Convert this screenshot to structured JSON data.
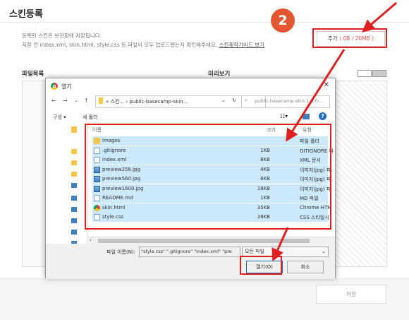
{
  "page": {
    "title": "스킨등록",
    "notice_line1": "등록된 스킨은 보관함에 저장됩니다.",
    "notice_line2": "저장 전 index.xml, skin.html, style.css 등 파일이 모두 업로드됐는지 확인해주세요.",
    "guide_link": "스킨제작가이드 보기",
    "add_button": {
      "label": "추가",
      "quota": "( 0B / 20MB )"
    },
    "file_list_label": "파일목록",
    "preview_label": "미리보기",
    "save_button": "저장",
    "step_number": "2"
  },
  "dialog": {
    "title": "열기",
    "close": "✕",
    "address": "« 스킨... › public-basecamp-skin...",
    "search_placeholder": "public-basecamp-skin-1.0.0-...",
    "toolbar": {
      "organize": "구성 ▾",
      "new_folder": "새 폴더"
    },
    "columns": {
      "name": "이름",
      "size": "크기",
      "type": "유형"
    },
    "files": [
      {
        "name": "images",
        "size": "",
        "type": "파일 폴더",
        "icon": "folder-icon"
      },
      {
        "name": ".gitignore",
        "size": "1KB",
        "type": "GITIGNORE 파",
        "icon": "file-icon"
      },
      {
        "name": "index.xml",
        "size": "8KB",
        "type": "XML 문서",
        "icon": "file-icon"
      },
      {
        "name": "preview256.jpg",
        "size": "4KB",
        "type": "이미지(jpg) 파",
        "icon": "image-icon"
      },
      {
        "name": "preview560.jpg",
        "size": "6KB",
        "type": "이미지(jpg) 파",
        "icon": "image-icon"
      },
      {
        "name": "preview1600.jpg",
        "size": "18KB",
        "type": "이미지(jpg) 파",
        "icon": "image-icon"
      },
      {
        "name": "README.md",
        "size": "1KB",
        "type": "MD 파일",
        "icon": "file-icon"
      },
      {
        "name": "skin.html",
        "size": "35KB",
        "type": "Chrome HTM",
        "icon": "chrome-icon"
      },
      {
        "name": "style.css",
        "size": "28KB",
        "type": "CSS 스타일시",
        "icon": "file-icon"
      }
    ],
    "filename_label": "파일 이름(N):",
    "filename_value": "\"style.css\" \".gitignore\" \"index.xml\" \"pre",
    "filetype_value": "모든 파일",
    "open_button": "열기(O)",
    "cancel_button": "취소"
  },
  "colors": {
    "accent_red": "#e02020",
    "step_orange": "#e2572f",
    "selection": "#cce8fb"
  }
}
